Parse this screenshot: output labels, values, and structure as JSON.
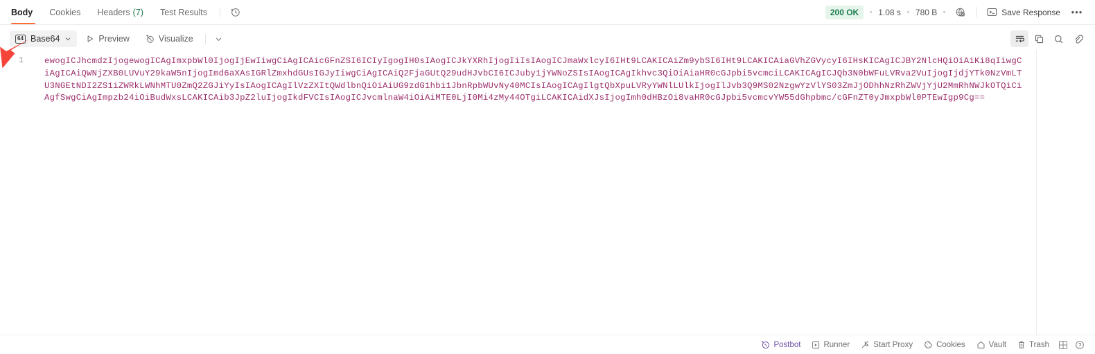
{
  "response_tabs": {
    "items": [
      {
        "label": "Body",
        "active": true,
        "count": ""
      },
      {
        "label": "Cookies",
        "active": false,
        "count": ""
      },
      {
        "label": "Headers",
        "active": false,
        "count": "(7)"
      },
      {
        "label": "Test Results",
        "active": false,
        "count": ""
      }
    ],
    "history_icon": "history-clock-icon"
  },
  "response_meta": {
    "status": "200 OK",
    "time": "1.08 s",
    "size": "780 B",
    "network_icon": "network-lock-icon",
    "save_response_label": "Save Response",
    "save_response_icon": "save-response-icon",
    "more_label": "•••",
    "status_color": "#1c7d4d",
    "status_bg": "#e6f5ec"
  },
  "format_toolbar": {
    "format_selected": "Base64",
    "format_icon_label": "64",
    "preview_label": "Preview",
    "visualize_label": "Visualize",
    "caret_icon": "chevron-down-icon",
    "tools": [
      {
        "name": "word-wrap-icon",
        "active": true
      },
      {
        "name": "copy-icon",
        "active": false
      },
      {
        "name": "search-icon",
        "active": false
      },
      {
        "name": "link-icon",
        "active": false
      }
    ]
  },
  "body": {
    "line_number": "1",
    "text_color": "#9c2f6b",
    "content": "ewogICJhcmdzIjogewogICAgImxpbWl0IjogIjEwIiwgCiAgICAicGFnZSI6ICIyIgogIH0sIAogICJkYXRhIjogIiIsIAogICJmaWxlcyI6IHt9LCAKICAiZm9ybSI6IHt9LCAKICAiaGVhZGVycyI6IHsKICAgICJBY2NlcHQiOiAiKi8qIiwgCiAgICAiQWNjZXB0LUVuY29kaW5nIjogImd6aXAsIGRlZmxhdGUsIGJyIiwgCiAgICAiQ2FjaGUtQ29udHJvbCI6ICJuby1jYWNoZSIsIAogICAgIkhvc3QiOiAiaHR0cGJpbi5vcmciLCAKICAgICJQb3N0bWFuLVRva2VuIjogIjdjYTk0NzVmLTU3NGEtNDI2ZS1iZWRkLWNhMTU0ZmQ2ZGJiYyIsIAogICAgIlVzZXItQWdlbnQiOiAiUG9zdG1hbi1JbnRpbWUvNy40MCIsIAogICAgIlgtQbXpuLVRyYWNlLUlkIjogIlJvb3Q9MS02NzgwYzVlYS03ZmJjODhhNzRhZWVjYjU2MmRhNWJkOTQiCiAgfSwgCiAgImpzb24iOiBudWxsLCAKICAib3JpZ2luIjogIkdFVCIsIAogICJvcmlnaW4iOiAiMTE0LjI0Mi4zMy44OTgiLCAKICAidXJsIjogImh0dHBzOi8vaHR0cGJpbi5vcmcvYW55dGhpbmc/cGFnZT0yJmxpbWl0PTEwIgp9Cg=="
  },
  "status_bar": {
    "items": [
      {
        "label": "Postbot",
        "icon": "postbot-icon"
      },
      {
        "label": "Runner",
        "icon": "runner-icon"
      },
      {
        "label": "Start Proxy",
        "icon": "proxy-icon"
      },
      {
        "label": "Cookies",
        "icon": "cookies-icon"
      },
      {
        "label": "Vault",
        "icon": "vault-icon"
      },
      {
        "label": "Trash",
        "icon": "trash-icon"
      }
    ],
    "layout_icon": "layout-panel-icon",
    "help_icon": "help-circle-icon"
  },
  "annotation": {
    "arrow_color": "#f5443a",
    "arrow_target": "base64-format-button"
  }
}
